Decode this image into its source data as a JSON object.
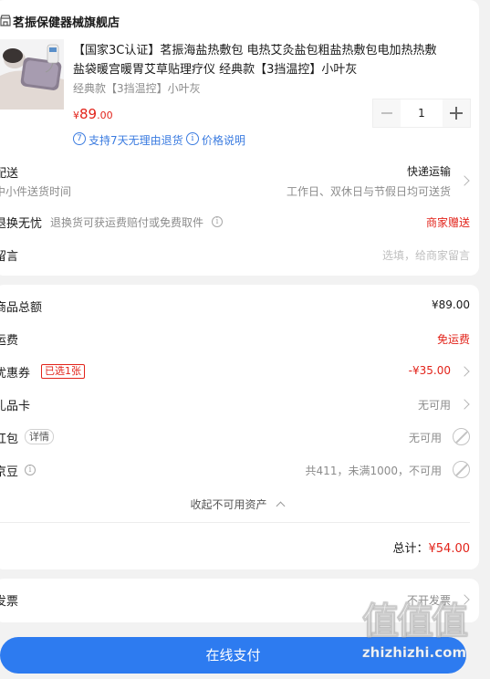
{
  "store": {
    "icon": "store-icon",
    "name": "茗振保健器械旗舰店"
  },
  "product": {
    "title_line1": "【国家3C认证】茗振海盐热敷包 电热艾灸盐包粗盐热敷包电加热热敷",
    "title_line2": "盐袋暖宫暖胃艾草贴理疗仪 经典款【3挡温控】小叶灰",
    "variant": "经典款【3挡温控】小叶灰",
    "price_symbol": "¥",
    "price_int": "89",
    "price_dec": ".00",
    "quantity": "1",
    "guarantee": "支持7天无理由退货",
    "guarantee_icon": "7",
    "price_explain": "价格说明"
  },
  "delivery": {
    "label": "配送",
    "method": "快递运输",
    "sub_label": "中小件送货时间",
    "time": "工作日、双休日与节假日均可送货"
  },
  "return": {
    "label": "退换无忧",
    "desc": "退换货可获运费赔付或免费取件",
    "value": "商家赠送"
  },
  "message": {
    "label": "留言",
    "placeholder": "选填，给商家留言"
  },
  "summary": {
    "goods_total_label": "商品总额",
    "goods_total": "¥89.00",
    "freight_label": "运费",
    "freight": "免运费",
    "coupon_label": "优惠券",
    "coupon_badge": "已选1张",
    "coupon_value": "-¥35.00",
    "gift_card_label": "礼品卡",
    "gift_card_value": "无可用",
    "red_packet_label": "红包",
    "red_packet_detail": "详情",
    "red_packet_value": "无可用",
    "jd_bean_label": "京豆",
    "jd_bean_value": "共411，未满1000，不可用",
    "collapse": "收起不可用资产",
    "total_label": "总计：",
    "total_value": "¥54.00"
  },
  "invoice": {
    "label": "发票",
    "value": "不开发票"
  },
  "pay_button": "在线支付",
  "watermark": {
    "big": "值值值",
    "small": "zhizhizhi.com"
  },
  "colors": {
    "accent": "#2d7bf0",
    "price_red": "#e2231a",
    "background": "#f2f2f2"
  }
}
